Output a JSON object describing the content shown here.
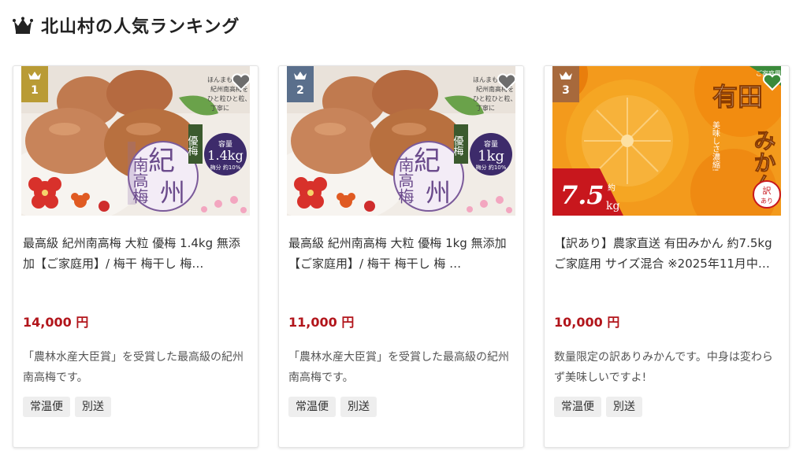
{
  "section": {
    "title": "北山村の人気ランキング"
  },
  "products": [
    {
      "rank": "1",
      "rank_color": "#b99b35",
      "name": "最高級 紀州南高梅 大粒 優梅 1.4kg 無添加【ご家庭用】/ 梅干 梅干し 梅…",
      "price": "14,000 円",
      "desc": "「農林水産大臣賞」を受賞した最高級の紀州南高梅です。",
      "tags": [
        "常温便",
        "別送"
      ],
      "image": {
        "seal_text": "紀州",
        "side_text": "南高梅",
        "badge_top": "容量",
        "badge_main": "1.4kg",
        "badge_sub": "梅分 約10%",
        "caption": "優梅",
        "corner_text": "ほんまもんの 紀州南高梅を ひと粒ひと粒、 丁寧に"
      }
    },
    {
      "rank": "2",
      "rank_color": "#5a6f8c",
      "name": "最高級 紀州南高梅 大粒 優梅 1kg 無添加【ご家庭用】/ 梅干 梅干し 梅 …",
      "price": "11,000 円",
      "desc": "「農林水産大臣賞」を受賞した最高級の紀州南高梅です。",
      "tags": [
        "常温便",
        "別送"
      ],
      "image": {
        "seal_text": "紀州",
        "side_text": "南高梅",
        "badge_top": "容量",
        "badge_main": "1kg",
        "badge_sub": "梅分 約10%",
        "caption": "優梅",
        "corner_text": "ほんまもんの 紀州南高梅を ひと粒ひと粒、 丁寧に"
      }
    },
    {
      "rank": "3",
      "rank_color": "#a7693c",
      "name": "【訳あり】農家直送 有田みかん 約7.5kg ご家庭用 サイズ混合 ※2025年11月中…",
      "price": "10,000 円",
      "desc": "数量限定の訳ありみかんです。中身は変わらず美味しいですよ!",
      "tags": [
        "常温便",
        "別送"
      ],
      "image": {
        "title": "有田",
        "subtitle": "みかん",
        "weight": "7.5",
        "unit": "kg",
        "approx": "約",
        "badge": "訳あり",
        "ribbon": "美味しさ濃縮!",
        "corner": "ご家庭用"
      }
    }
  ]
}
